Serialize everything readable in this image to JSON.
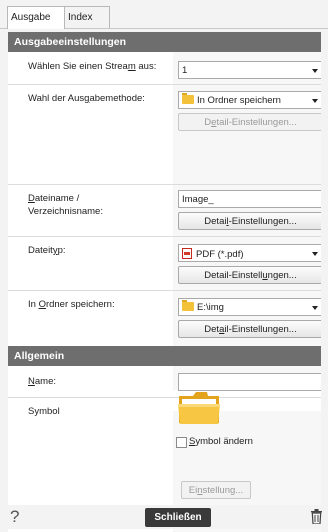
{
  "tabs": [
    "Ausgabe",
    "Index"
  ],
  "sections": {
    "output_settings": "Ausgabeeinstellungen",
    "general": "Allgemein"
  },
  "labels": {
    "stream_pre": "Wählen Sie einen Strea",
    "stream_u": "m",
    "stream_post": " aus:",
    "method_pre": "Wahl der Aus",
    "method_u": "g",
    "method_post": "abemethode:",
    "filename_u": "D",
    "filename_post": "ateiname /",
    "filename_line2": "Verzeichnisname:",
    "filetype_pre": "Dateit",
    "filetype_u": "y",
    "filetype_post": "p:",
    "folder_pre": "In ",
    "folder_u": "O",
    "folder_post": "rdner speichern:",
    "name_u": "N",
    "name_post": "ame:",
    "symbol": "Symbol"
  },
  "fields": {
    "stream_value": "1",
    "method_value": "In Ordner speichern",
    "filename_value": "Image_",
    "filetype_value": "PDF (*.pdf)",
    "folder_value": "E:\\img",
    "name_value": ""
  },
  "buttons": {
    "detail_method_pre": "D",
    "detail_method_u": "e",
    "detail_method_post": "tail-Einstellungen...",
    "detail_filename_pre": "Detai",
    "detail_filename_u": "l",
    "detail_filename_post": "-Einstellungen...",
    "detail_filetype_pre": "Detail-Einstell",
    "detail_filetype_u": "u",
    "detail_filetype_post": "ngen...",
    "detail_folder_pre": "Det",
    "detail_folder_u": "a",
    "detail_folder_post": "il-Einstellungen...",
    "symbol_change_u": "S",
    "symbol_change_post": "ymbol ändern",
    "settings_pre": "Ei",
    "settings_u": "n",
    "settings_post": "stellung...",
    "close": "Schließen",
    "help": "?"
  }
}
